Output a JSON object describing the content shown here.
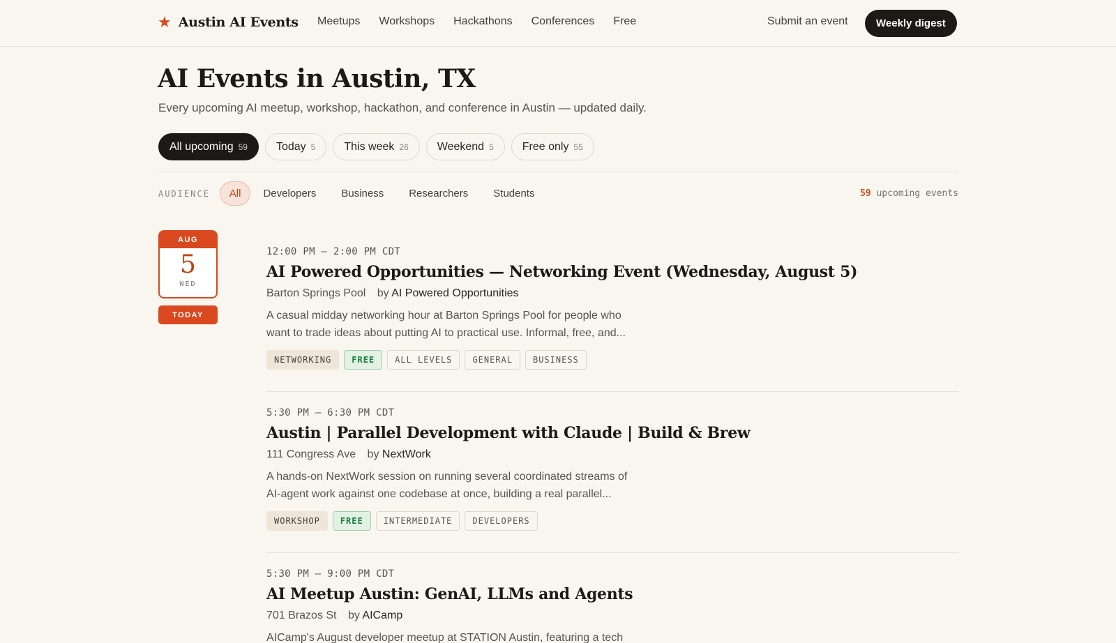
{
  "header": {
    "brand": "Austin AI Events",
    "nav": [
      "Meetups",
      "Workshops",
      "Hackathons",
      "Conferences",
      "Free"
    ],
    "submit_label": "Submit an event",
    "digest_label": "Weekly digest"
  },
  "hero": {
    "title": "AI Events in Austin, TX",
    "subtitle": "Every upcoming AI meetup, workshop, hackathon, and conference in Austin — updated daily."
  },
  "filters": [
    {
      "label": "All upcoming",
      "count": "59"
    },
    {
      "label": "Today",
      "count": "5"
    },
    {
      "label": "This week",
      "count": "26"
    },
    {
      "label": "Weekend",
      "count": "5"
    },
    {
      "label": "Free only",
      "count": "55"
    }
  ],
  "audience": {
    "label": "AUDIENCE",
    "options": [
      "All",
      "Developers",
      "Business",
      "Researchers",
      "Students"
    ]
  },
  "summary": {
    "count": "59",
    "suffix": "upcoming events"
  },
  "date": {
    "month": "AUG",
    "day": "5",
    "weekday": "WED",
    "badge": "TODAY"
  },
  "events": [
    {
      "time": "12:00 PM – 2:00 PM CDT",
      "title": "AI Powered Opportunities — Networking Event (Wednesday, August 5)",
      "venue": "Barton Springs Pool",
      "by": "by",
      "organizer": "AI Powered Opportunities",
      "desc_1": "A casual midday networking hour at Barton Springs Pool for people who",
      "desc_2": "want to trade ideas about putting AI to practical use. Informal, free, and...",
      "tags": [
        "NETWORKING",
        "FREE",
        "ALL LEVELS",
        "GENERAL",
        "BUSINESS"
      ]
    },
    {
      "time": "5:30 PM – 6:30 PM CDT",
      "title": "Austin | Parallel Development with Claude | Build & Brew",
      "venue": "111 Congress Ave",
      "by": "by",
      "organizer": "NextWork",
      "desc_1": "A hands-on NextWork session on running several coordinated streams of",
      "desc_2": "AI-agent work against one codebase at once, building a real parallel...",
      "tags": [
        "WORKSHOP",
        "FREE",
        "INTERMEDIATE",
        "DEVELOPERS"
      ]
    },
    {
      "time": "5:30 PM – 9:00 PM CDT",
      "title": "AI Meetup Austin: GenAI, LLMs and Agents",
      "venue": "701 Brazos St",
      "by": "by",
      "organizer": "AICamp",
      "desc_1": "AICamp's August developer meetup at STATION Austin, featuring a tech",
      "desc_2": "",
      "tags": []
    }
  ],
  "colors": {
    "accent": "#d9481e",
    "background": "#f9f6f0",
    "ink": "#1c1917",
    "free_green": "#15803d"
  }
}
